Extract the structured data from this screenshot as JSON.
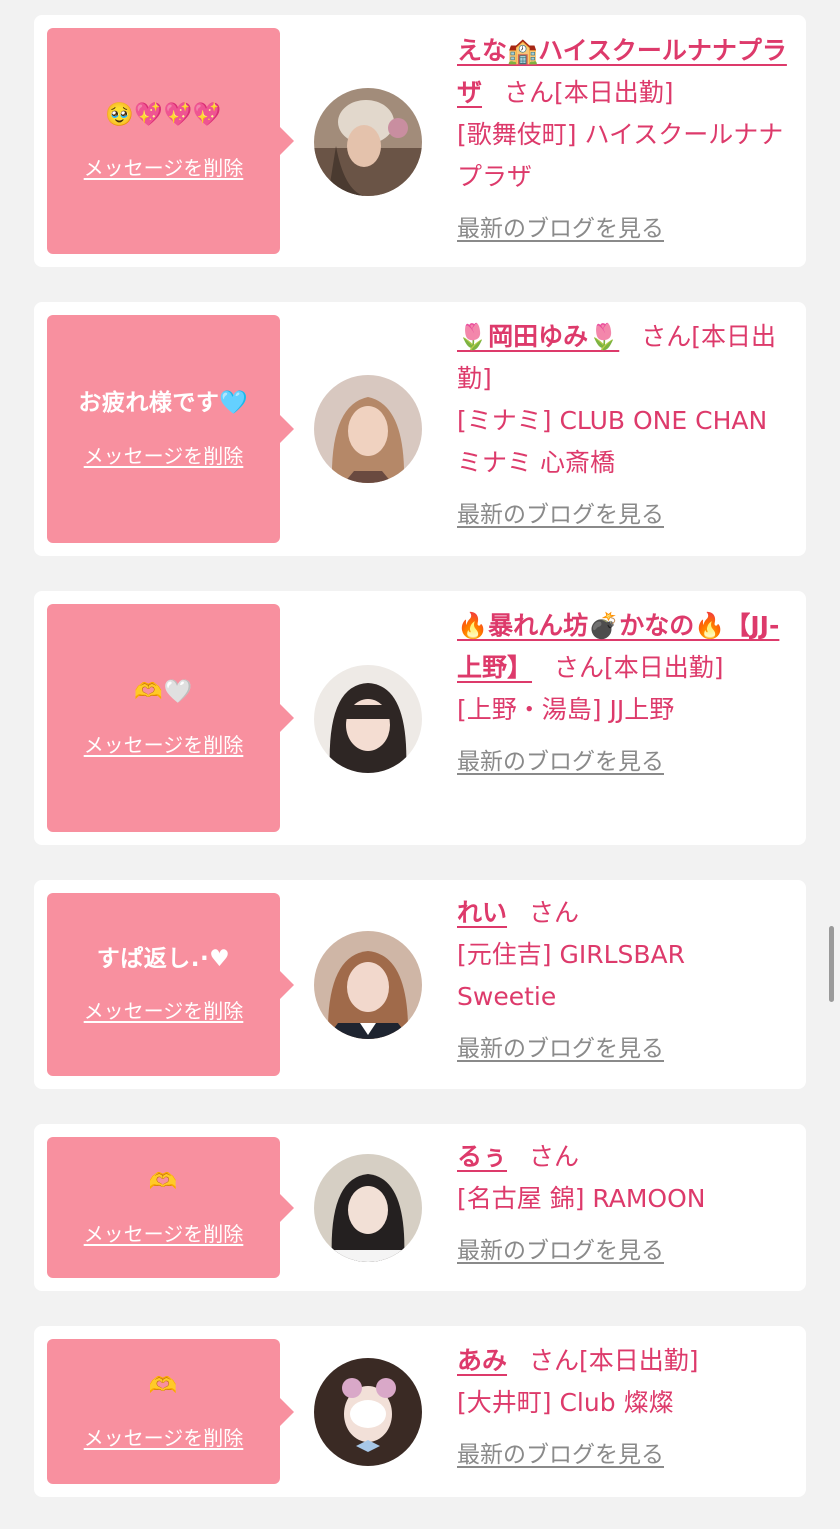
{
  "colors": {
    "background": "#f2f2f2",
    "bubble": "#f8909f",
    "accent": "#dd3a6b",
    "muted": "#8a8a8a"
  },
  "labels": {
    "delete": "メッセージを削除",
    "blog": "最新のブログを見る",
    "san": "さん"
  },
  "cards": [
    {
      "message": "🥹💖💖💖",
      "name": "えな🏫ハイスクールナナプラザ",
      "status": "[本日出勤]",
      "shop": "[歌舞伎町] ハイスクールナナプラザ",
      "avatar_icon": "girl-photo"
    },
    {
      "message": "お疲れ様です🩵",
      "name": "🌷岡田ゆみ🌷",
      "status": "[本日出勤]",
      "shop": "[ミナミ] CLUB ONE CHAN ミナミ 心斎橋",
      "avatar_icon": "girl-photo"
    },
    {
      "message": "🫶🤍",
      "name": "🔥暴れん坊💣かなの🔥【JJ-上野】",
      "status": "[本日出勤]",
      "shop": "[上野・湯島] JJ上野",
      "avatar_icon": "girl-photo"
    },
    {
      "message": "すぱ返し.·♥",
      "name": "れい",
      "status": "",
      "shop": "[元住吉] GIRLSBAR Sweetie",
      "avatar_icon": "girl-photo"
    },
    {
      "message": "🫶",
      "name": "るぅ",
      "status": "",
      "shop": "[名古屋 錦] RAMOON",
      "avatar_icon": "girl-photo"
    },
    {
      "message": "🫶",
      "name": "あみ",
      "status": "[本日出勤]",
      "shop": "[大井町] Club 燦燦",
      "avatar_icon": "girl-photo"
    }
  ]
}
